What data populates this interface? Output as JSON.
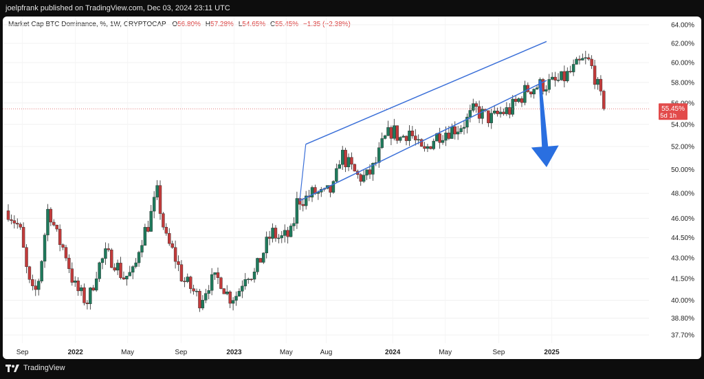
{
  "header": {
    "published": "joelpfrank published on TradingView.com, Dec 03, 2024 23:11 UTC"
  },
  "legend": {
    "symbol": "Market Cap BTC Dominance, %, 1W, CRYPTOCAP",
    "open_label": "O",
    "open": "56.80%",
    "high_label": "H",
    "high": "57.28%",
    "low_label": "L",
    "low": "54.65%",
    "close_label": "C",
    "close": "55.45%",
    "change": "−1.35 (−2.38%)"
  },
  "price_tag": {
    "value": "55.45%",
    "countdown": "5d 1h"
  },
  "footer": {
    "brand": "TradingView"
  },
  "colors": {
    "up": "#1f7a5c",
    "down": "#c23b3b",
    "channel": "#3a6fd8",
    "arrow": "#2a6fe0"
  },
  "chart_data": {
    "type": "candlestick",
    "yaxis": {
      "scale": "log",
      "ticks": [
        "64.00%",
        "62.00%",
        "60.00%",
        "58.00%",
        "56.00%",
        "54.00%",
        "52.00%",
        "50.00%",
        "48.00%",
        "46.00%",
        "44.50%",
        "43.00%",
        "41.50%",
        "40.00%",
        "38.80%",
        "37.70%"
      ]
    },
    "xaxis": {
      "ticks": [
        "Sep",
        "2022",
        "May",
        "Sep",
        "2023",
        "May",
        "Aug",
        "2024",
        "May",
        "Sep",
        "2025"
      ]
    },
    "annotations": {
      "channel_upper": [
        {
          "x": "2023-06-15",
          "y": 52.2
        },
        {
          "x": "2024-12-20",
          "y": 62.2
        }
      ],
      "channel_lower": [
        {
          "x": "2023-06-01",
          "y": 47.4
        },
        {
          "x": "2024-12-20",
          "y": 58.2
        }
      ],
      "arrow": {
        "from": {
          "x": "2024-12-05",
          "y": 58.2
        },
        "to": {
          "x": "2024-12-20",
          "y": 50.2
        }
      }
    },
    "last_close": 55.45
  }
}
